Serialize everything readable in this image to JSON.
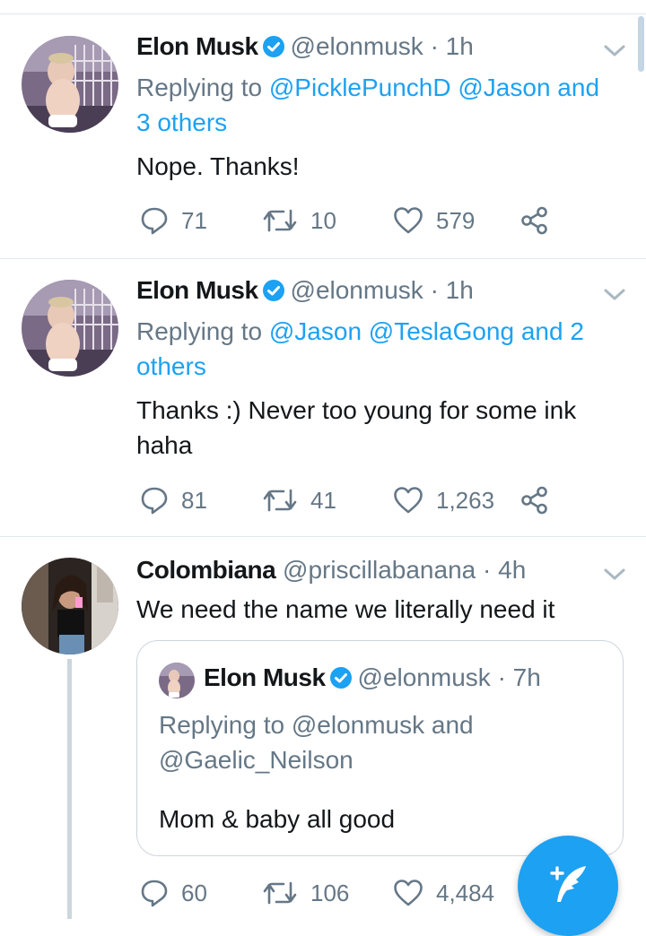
{
  "tweets": [
    {
      "name": "Elon Musk",
      "handle": "@elonmusk",
      "time": "· 1h",
      "replying_prefix": "Replying to",
      "replying_l1": "@PicklePunchD @Jason and",
      "replying_l2": "3 others",
      "text_l1": "Nope. Thanks!",
      "replies": "71",
      "retweets": "10",
      "likes": "579"
    },
    {
      "name": "Elon Musk",
      "handle": "@elonmusk",
      "time": "· 1h",
      "replying_prefix": "Replying to",
      "replying_l1": "@Jason @TeslaGong and 2",
      "replying_l2": "others",
      "text_l1": "Thanks :) Never too young for some ink",
      "text_l2": "haha",
      "replies": "81",
      "retweets": "41",
      "likes": "1,263"
    },
    {
      "name": "Colombiana",
      "handle": "@priscillabanana",
      "time": "· 4h",
      "text_l1": "We need the name we literally need it",
      "replies": "60",
      "retweets": "106",
      "likes": "4,484"
    }
  ],
  "quoted_tweet": {
    "name": "Elon Musk",
    "handle": "@elonmusk",
    "time": "· 7h",
    "replying_l1": "Replying to @elonmusk and",
    "replying_l2": "@Gaelic_Neilson",
    "text": "Mom & baby all good"
  },
  "icons": {
    "verified": "verified-badge-icon",
    "reply": "reply-icon",
    "retweet": "retweet-icon",
    "like": "heart-icon",
    "share": "share-icon",
    "more": "chevron-down-icon",
    "compose": "compose-tweet-icon"
  },
  "colors": {
    "accent": "#1da1f2",
    "text": "#14171a",
    "muted": "#657786",
    "border": "#e1e8ed"
  }
}
